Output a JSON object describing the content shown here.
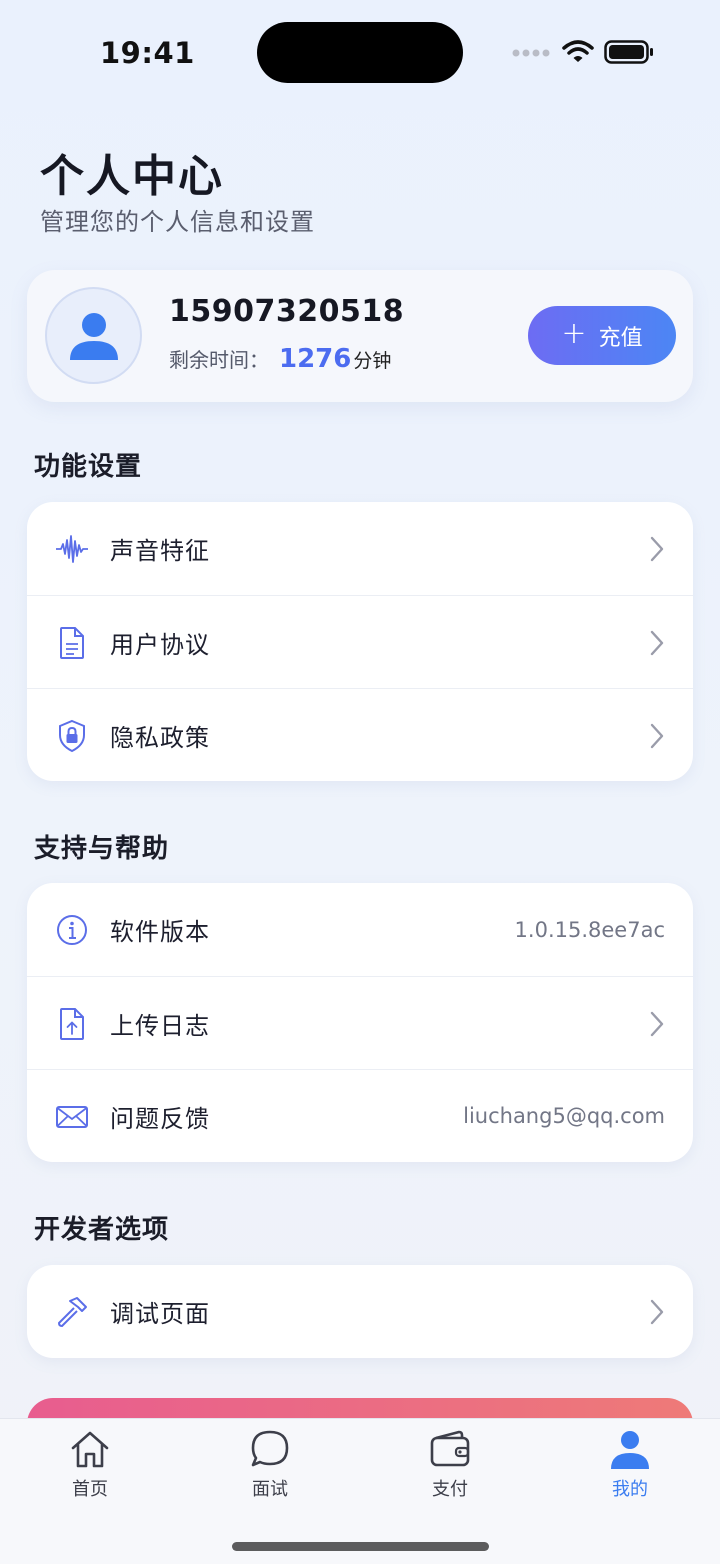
{
  "status_bar": {
    "time": "19:41"
  },
  "header": {
    "title": "个人中心",
    "subtitle": "管理您的个人信息和设置"
  },
  "profile": {
    "phone": "15907320518",
    "remain_label": "剩余时间：",
    "remain_value": "1276",
    "remain_unit": "分钟",
    "recharge_label": "充值"
  },
  "sections": {
    "functions": {
      "title": "功能设置",
      "items": [
        {
          "label": "声音特征",
          "icon": "waveform-icon"
        },
        {
          "label": "用户协议",
          "icon": "document-icon"
        },
        {
          "label": "隐私政策",
          "icon": "shield-lock-icon"
        }
      ]
    },
    "support": {
      "title": "支持与帮助",
      "items": [
        {
          "label": "软件版本",
          "icon": "info-icon",
          "value": "1.0.15.8ee7ac"
        },
        {
          "label": "上传日志",
          "icon": "upload-file-icon"
        },
        {
          "label": "问题反馈",
          "icon": "mail-icon",
          "value": "liuchang5@qq.com"
        }
      ]
    },
    "developer": {
      "title": "开发者选项",
      "items": [
        {
          "label": "调试页面",
          "icon": "hammer-icon"
        }
      ]
    }
  },
  "tabbar": {
    "items": [
      {
        "label": "首页",
        "icon": "home-icon"
      },
      {
        "label": "面试",
        "icon": "chat-bubble-icon"
      },
      {
        "label": "支付",
        "icon": "wallet-icon"
      },
      {
        "label": "我的",
        "icon": "person-icon",
        "active": true
      }
    ]
  },
  "colors": {
    "accent": "#4c6cf0",
    "tab_active": "#3b7df0",
    "icon": "#5b6ee8"
  }
}
